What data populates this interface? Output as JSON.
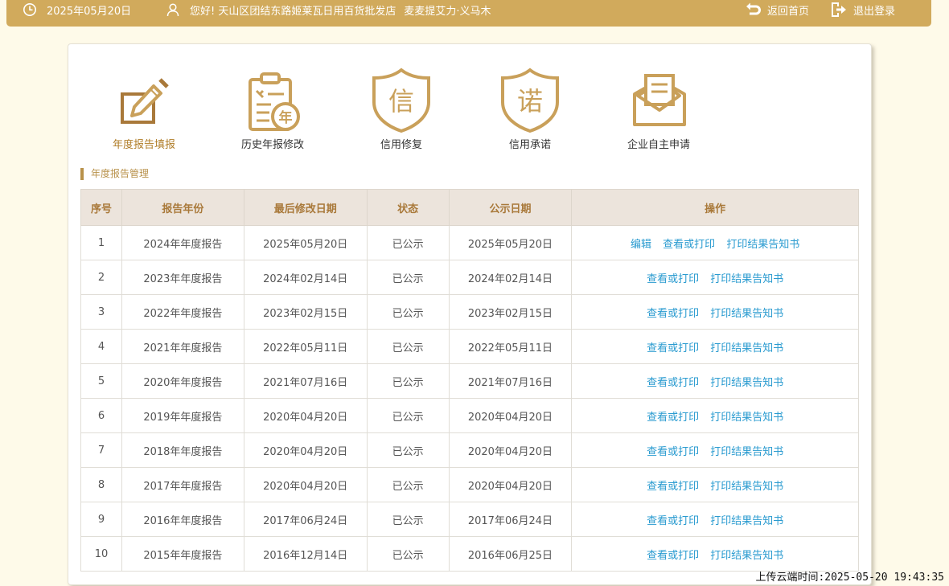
{
  "header": {
    "date": "2025年05月20日",
    "greeting": "您好! 天山区团结东路姬莱瓦日用百货批发店",
    "user_name": "麦麦提艾力·义马木",
    "home_label": "返回首页",
    "logout_label": "退出登录",
    "icons": [
      "clock-icon",
      "user-icon",
      "return-icon",
      "logout-icon"
    ]
  },
  "features": [
    {
      "label": "年度报告填报",
      "icon": "edit-report-icon",
      "active": true
    },
    {
      "label": "历史年报修改",
      "icon": "history-clipboard-icon",
      "active": false
    },
    {
      "label": "信用修复",
      "icon": "shield-xin-icon",
      "active": false,
      "glyph": "信"
    },
    {
      "label": "信用承诺",
      "icon": "shield-nuo-icon",
      "active": false,
      "glyph": "诺"
    },
    {
      "label": "企业自主申请",
      "icon": "envelope-icon",
      "active": false
    }
  ],
  "clipboard_glyph": "年",
  "section_title": "年度报告管理",
  "table": {
    "headers": [
      "序号",
      "报告年份",
      "最后修改日期",
      "状态",
      "公示日期",
      "操作"
    ],
    "rows": [
      {
        "no": "1",
        "year": "2024年年度报告",
        "modified": "2025年05月20日",
        "status": "已公示",
        "published": "2025年05月20日",
        "actions": [
          "编辑",
          "查看或打印",
          "打印结果告知书"
        ]
      },
      {
        "no": "2",
        "year": "2023年年度报告",
        "modified": "2024年02月14日",
        "status": "已公示",
        "published": "2024年02月14日",
        "actions": [
          "查看或打印",
          "打印结果告知书"
        ]
      },
      {
        "no": "3",
        "year": "2022年年度报告",
        "modified": "2023年02月15日",
        "status": "已公示",
        "published": "2023年02月15日",
        "actions": [
          "查看或打印",
          "打印结果告知书"
        ]
      },
      {
        "no": "4",
        "year": "2021年年度报告",
        "modified": "2022年05月11日",
        "status": "已公示",
        "published": "2022年05月11日",
        "actions": [
          "查看或打印",
          "打印结果告知书"
        ]
      },
      {
        "no": "5",
        "year": "2020年年度报告",
        "modified": "2021年07月16日",
        "status": "已公示",
        "published": "2021年07月16日",
        "actions": [
          "查看或打印",
          "打印结果告知书"
        ]
      },
      {
        "no": "6",
        "year": "2019年年度报告",
        "modified": "2020年04月20日",
        "status": "已公示",
        "published": "2020年04月20日",
        "actions": [
          "查看或打印",
          "打印结果告知书"
        ]
      },
      {
        "no": "7",
        "year": "2018年年度报告",
        "modified": "2020年04月20日",
        "status": "已公示",
        "published": "2020年04月20日",
        "actions": [
          "查看或打印",
          "打印结果告知书"
        ]
      },
      {
        "no": "8",
        "year": "2017年年度报告",
        "modified": "2020年04月20日",
        "status": "已公示",
        "published": "2020年04月20日",
        "actions": [
          "查看或打印",
          "打印结果告知书"
        ]
      },
      {
        "no": "9",
        "year": "2016年年度报告",
        "modified": "2017年06月24日",
        "status": "已公示",
        "published": "2017年06月24日",
        "actions": [
          "查看或打印",
          "打印结果告知书"
        ]
      },
      {
        "no": "10",
        "year": "2015年年度报告",
        "modified": "2016年12月14日",
        "status": "已公示",
        "published": "2016年06月25日",
        "actions": [
          "查看或打印",
          "打印结果告知书"
        ]
      }
    ]
  },
  "upload_time": "上传云端时间:2025-05-20 19:43:35",
  "colors": {
    "header_bg": "#d1aa5c",
    "accent_gold": "#c9a05a",
    "link_blue": "#2a9bd0",
    "page_bg": "#fefae9",
    "table_header_bg": "#ece4dc"
  }
}
